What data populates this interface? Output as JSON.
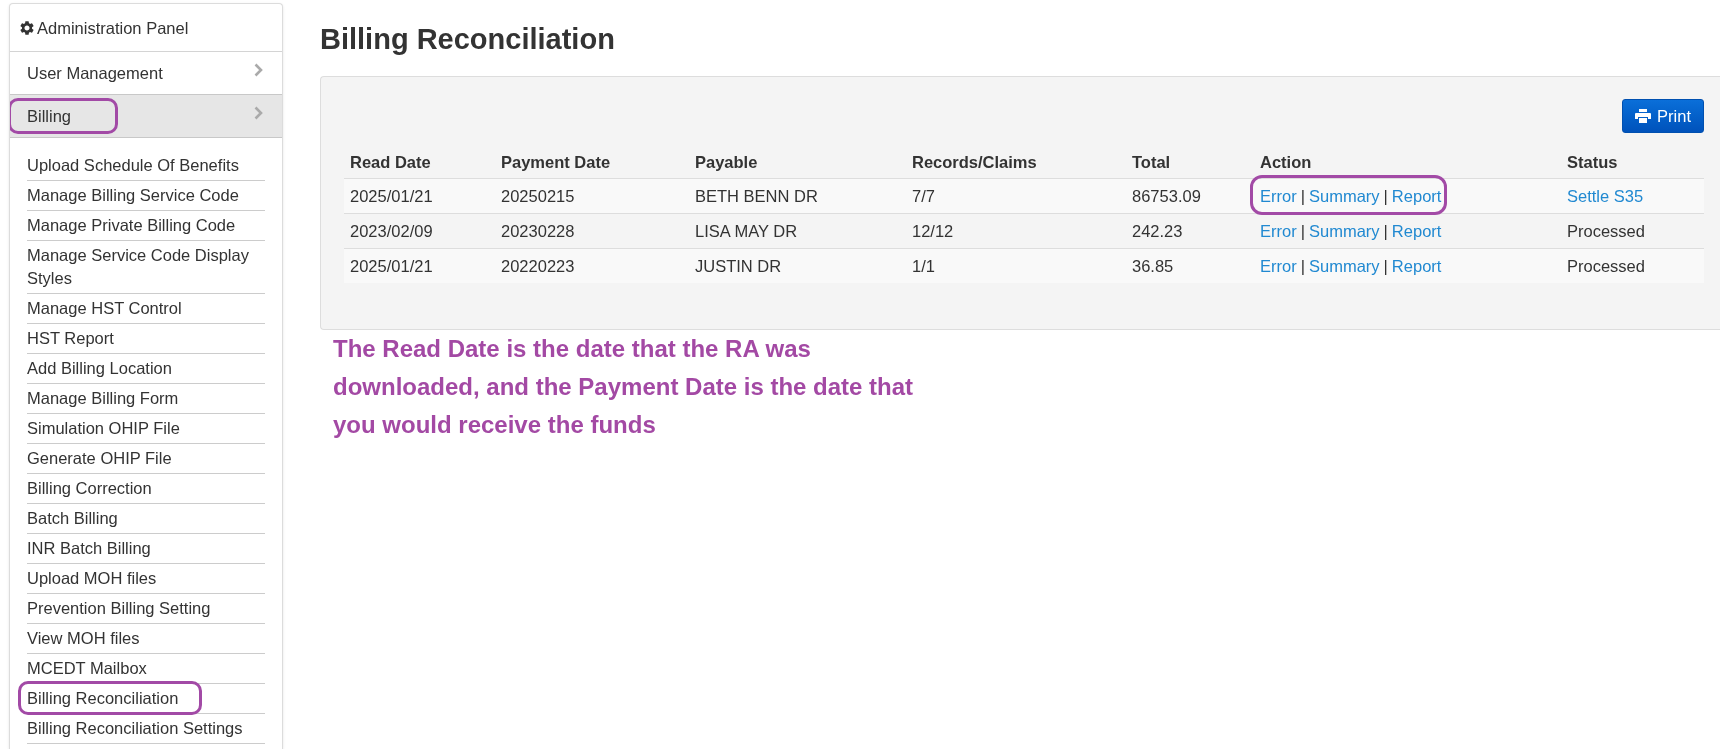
{
  "sidebar": {
    "title": "Administration Panel",
    "items": [
      {
        "label": "User Management",
        "expanded": false,
        "circled": false
      },
      {
        "label": "Billing",
        "expanded": true,
        "circled": true,
        "children": [
          {
            "label": "Upload Schedule Of Benefits",
            "circled": false
          },
          {
            "label": "Manage Billing Service Code",
            "circled": false
          },
          {
            "label": "Manage Private Billing Code",
            "circled": false
          },
          {
            "label": "Manage Service Code Display Styles",
            "circled": false
          },
          {
            "label": "Manage HST Control",
            "circled": false
          },
          {
            "label": "HST Report",
            "circled": false
          },
          {
            "label": "Add Billing Location",
            "circled": false
          },
          {
            "label": "Manage Billing Form",
            "circled": false
          },
          {
            "label": "Simulation OHIP File",
            "circled": false
          },
          {
            "label": "Generate OHIP File",
            "circled": false
          },
          {
            "label": "Billing Correction",
            "circled": false
          },
          {
            "label": "Batch Billing",
            "circled": false
          },
          {
            "label": "INR Batch Billing",
            "circled": false
          },
          {
            "label": "Upload MOH files",
            "circled": false
          },
          {
            "label": "Prevention Billing Setting",
            "circled": false
          },
          {
            "label": "View MOH files",
            "circled": false
          },
          {
            "label": "MCEDT Mailbox",
            "circled": false
          },
          {
            "label": "Billing Reconciliation",
            "circled": true
          },
          {
            "label": "Billing Reconciliation Settings",
            "circled": false
          }
        ]
      }
    ]
  },
  "page": {
    "title": "Billing Reconciliation"
  },
  "panel": {
    "print_button": {
      "label": "Print"
    },
    "table": {
      "columns": [
        "Read Date",
        "Payment Date",
        "Payable",
        "Records/Claims",
        "Total",
        "Action",
        "Status"
      ],
      "rows": [
        {
          "cells": [
            "2025/01/21",
            "20250215",
            "BETH BENN DR",
            "7/7",
            "86753.09"
          ],
          "action": [
            {
              "kind": "link",
              "text": "Error"
            },
            {
              "kind": "separator",
              "text": "|"
            },
            {
              "kind": "link",
              "text": "Summary"
            },
            {
              "kind": "separator",
              "text": "|"
            },
            {
              "kind": "link",
              "text": "Report"
            }
          ],
          "action_circled": true,
          "status": {
            "kind": "link",
            "text": "Settle S35"
          }
        },
        {
          "cells": [
            "2023/02/09",
            "20230228",
            "LISA MAY DR",
            "12/12",
            "242.23"
          ],
          "action": [
            {
              "kind": "link",
              "text": "Error"
            },
            {
              "kind": "separator",
              "text": "|"
            },
            {
              "kind": "link",
              "text": "Summary"
            },
            {
              "kind": "separator",
              "text": "|"
            },
            {
              "kind": "link",
              "text": "Report"
            }
          ],
          "action_circled": false,
          "status": {
            "kind": "text",
            "text": "Processed"
          }
        },
        {
          "cells": [
            "2025/01/21",
            "20220223",
            "JUSTIN DR",
            "1/1",
            "36.85"
          ],
          "action": [
            {
              "kind": "link",
              "text": "Error"
            },
            {
              "kind": "separator",
              "text": "|"
            },
            {
              "kind": "link",
              "text": "Summary"
            },
            {
              "kind": "separator",
              "text": "|"
            },
            {
              "kind": "link",
              "text": "Report"
            }
          ],
          "action_circled": false,
          "status": {
            "kind": "text",
            "text": "Processed"
          }
        }
      ]
    }
  },
  "annotation": {
    "text": "The Read Date is the date that the RA was downloaded, and the Payment Date is the date that you would receive the funds"
  }
}
